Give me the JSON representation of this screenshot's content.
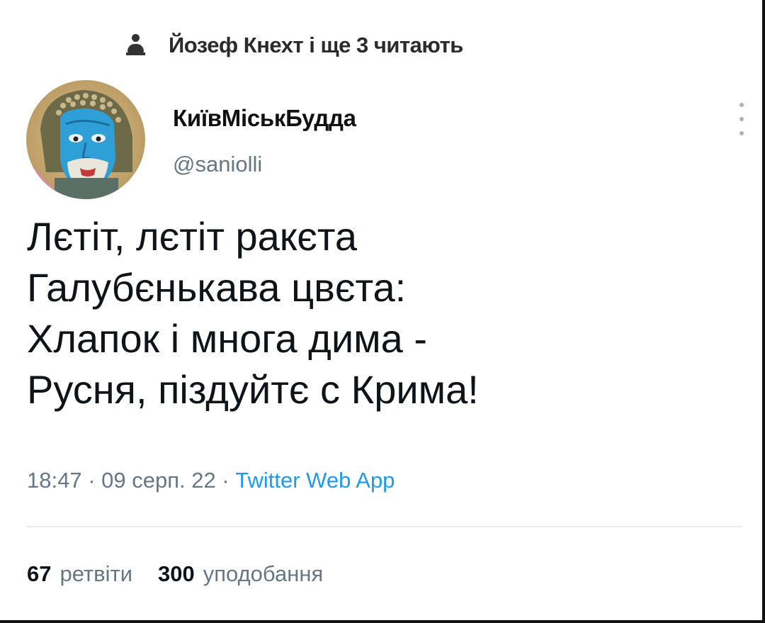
{
  "social_context": {
    "icon": "person-icon",
    "text": "Йозеф Кнехт і ще 3 читають"
  },
  "author": {
    "avatar": "avatar-blue-face",
    "name": "КиївМіськБудда",
    "handle": "@saniolli"
  },
  "tweet": {
    "lines": [
      "Лєтіт, лєтіт ракєта",
      "Галубєнькава цвєта:",
      "Хлапок і многа дима -",
      "Русня, піздуйтє с Крима!"
    ]
  },
  "meta": {
    "time": "18:47",
    "separator": "·",
    "date": "09 серп. 22",
    "source": "Twitter Web App"
  },
  "stats": {
    "retweets_count": "67",
    "retweets_label": "ретвіти",
    "likes_count": "300",
    "likes_label": "уподобання"
  },
  "colors": {
    "text": "#0f1419",
    "secondary": "#657786",
    "link": "#1d9bf0",
    "divider": "#e6ecf0"
  }
}
